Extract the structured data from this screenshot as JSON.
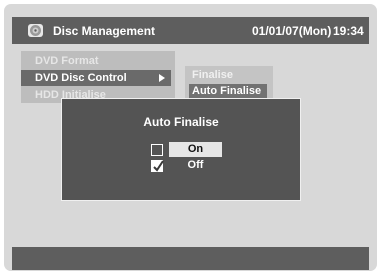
{
  "header": {
    "title": "Disc Management",
    "date": "01/01/07(Mon)",
    "time": "19:34",
    "icon": "disc-icon"
  },
  "menu": {
    "items": [
      {
        "label": "DVD Format",
        "selected": false
      },
      {
        "label": "DVD Disc Control",
        "selected": true
      },
      {
        "label": "HDD Initialise",
        "selected": false
      }
    ]
  },
  "submenu": {
    "items": [
      {
        "label": "Finalise",
        "selected": false
      },
      {
        "label": "Auto Finalise",
        "selected": true
      }
    ]
  },
  "dialog": {
    "title": "Auto Finalise",
    "options": [
      {
        "label": "On",
        "checked": false,
        "highlighted": true
      },
      {
        "label": "Off",
        "checked": true,
        "highlighted": false
      }
    ]
  },
  "colors": {
    "background": "#d8d8d8",
    "bar": "#5e5e5e",
    "dialog": "#545454",
    "highlight": "#e6e6e6"
  }
}
